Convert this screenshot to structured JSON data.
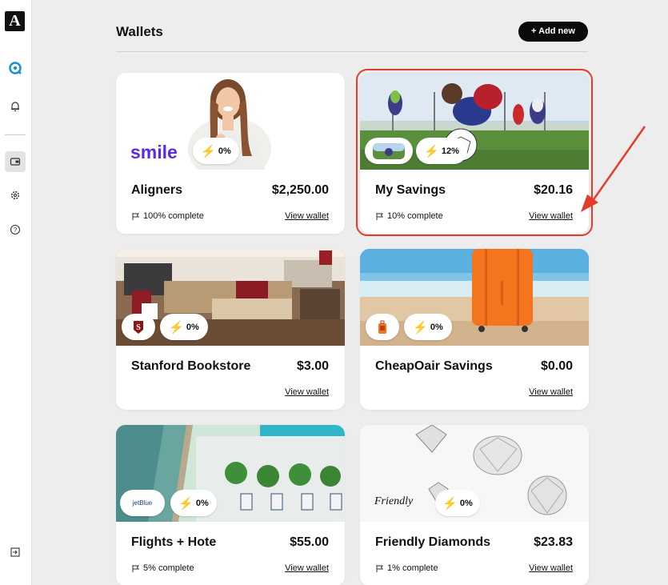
{
  "sidebar": {
    "logo": "A",
    "items": [
      {
        "name": "brand-icon"
      },
      {
        "name": "bell-icon"
      },
      {
        "name": "wallet-icon"
      },
      {
        "name": "gear-icon"
      },
      {
        "name": "help-icon"
      },
      {
        "name": "logout-icon"
      }
    ]
  },
  "header": {
    "title": "Wallets",
    "add_label": "+ Add new"
  },
  "cards": [
    {
      "name": "Aligners",
      "amount": "$2,250.00",
      "progress": "100% complete",
      "link": "View wallet",
      "boost": "0%",
      "brand": "smile"
    },
    {
      "name": "My Savings",
      "amount": "$20.16",
      "progress": "10% complete",
      "link": "View wallet",
      "boost": "12%"
    },
    {
      "name": "Stanford Bookstore",
      "amount": "$3.00",
      "link": "View wallet",
      "boost": "0%"
    },
    {
      "name": "CheapOair Savings",
      "amount": "$0.00",
      "link": "View wallet",
      "boost": "0%"
    },
    {
      "name": "Flights + Hote",
      "amount": "$55.00",
      "progress": "5% complete",
      "link": "View wallet",
      "boost": "0%",
      "brand": "jetBlue"
    },
    {
      "name": "Friendly Diamonds",
      "amount": "$23.83",
      "progress": "1% complete",
      "link": "View wallet",
      "boost": "0%",
      "brand": "Friendly"
    }
  ],
  "colors": {
    "accent": "#e53b2b",
    "brand_smile": "#5a2be0",
    "bolt": "#f5b400"
  }
}
